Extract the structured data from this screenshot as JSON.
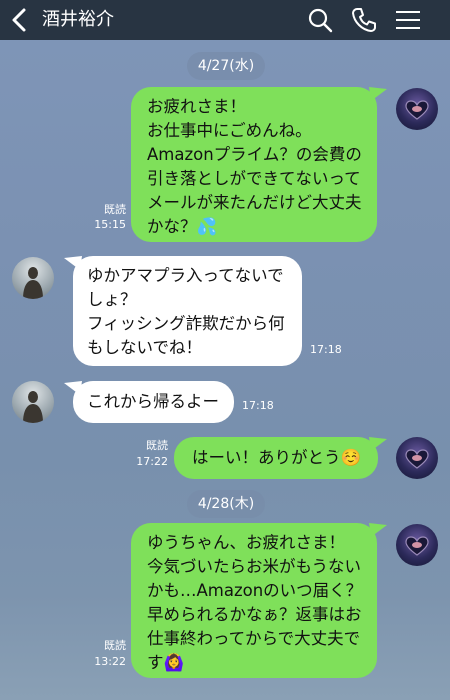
{
  "header": {
    "title": "酒井裕介",
    "icons": [
      "back-arrow-icon",
      "search-icon",
      "phone-icon",
      "menu-icon"
    ]
  },
  "dates": [
    "4/27(水)",
    "4/28(木)"
  ],
  "messages": [
    {
      "side": "right",
      "text": "お疲れさま！\nお仕事中にごめんね。\nAmazonプライム？の会費の\n引き落としができてないって\nメールが来たんだけど大丈夫\nかな？💦",
      "read": "既読",
      "time": "15:15"
    },
    {
      "side": "left",
      "text": "ゆかアマプラ入ってないで\nしょ？\nフィッシング詐欺だから何\nもしないでね！",
      "time": "17:18"
    },
    {
      "side": "left",
      "text": "これから帰るよー",
      "time": "17:18"
    },
    {
      "side": "right",
      "text": "はーい！ありがとう☺️",
      "read": "既読",
      "time": "17:22"
    },
    {
      "side": "right",
      "text": "ゆうちゃん、お疲れさま！\n今気づいたらお米がもうない\nかも…Amazonのいつ届く？\n早められるかなぁ？返事はお\n仕事終わってからで大丈夫で\nす🙆‍♀️",
      "read": "既読",
      "time": "13:22"
    }
  ],
  "colors": {
    "header": "#283442",
    "bubble_self": "#7fe05a",
    "bubble_other": "#ffffff"
  }
}
